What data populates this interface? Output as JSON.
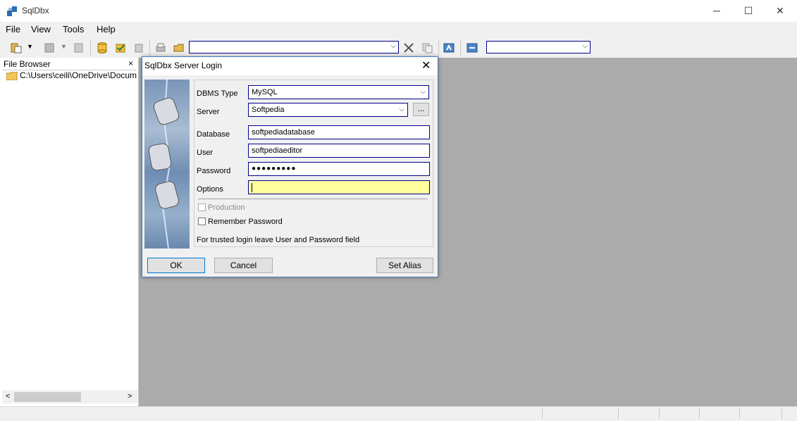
{
  "window": {
    "title": "SqlDbx",
    "minimize": "─",
    "maximize": "☐",
    "close": "✕"
  },
  "menu": {
    "items": [
      {
        "label": "File"
      },
      {
        "label": "View"
      },
      {
        "label": "Tools"
      },
      {
        "label": "Help"
      }
    ]
  },
  "toolbar": {
    "combo1_value": "",
    "combo2_value": ""
  },
  "file_browser": {
    "title": "File Browser",
    "close": "×",
    "path": "C:\\Users\\ceili\\OneDrive\\Docum",
    "scroll_left": "<",
    "scroll_right": ">"
  },
  "dialog": {
    "title": "SqlDbx Server Login",
    "close": "✕",
    "fields": {
      "dbms_type": {
        "label": "DBMS Type",
        "value": "MySQL"
      },
      "server": {
        "label": "Server",
        "value": "Softpedia",
        "browse": "..."
      },
      "database": {
        "label": "Database",
        "value": "softpediadatabase"
      },
      "user": {
        "label": "User",
        "value": "softpediaeditor"
      },
      "password": {
        "label": "Password",
        "value": "●●●●●●●●●"
      },
      "options": {
        "label": "Options",
        "value": ""
      }
    },
    "production_label": "Production",
    "remember_label": "Remember Password",
    "hint": "For trusted login leave User and Password field",
    "buttons": {
      "ok": "OK",
      "cancel": "Cancel",
      "set_alias": "Set Alias"
    }
  },
  "colors": {
    "accent_border": "#00008b",
    "options_bg": "#ffff9e",
    "main_bg": "#ababab"
  }
}
